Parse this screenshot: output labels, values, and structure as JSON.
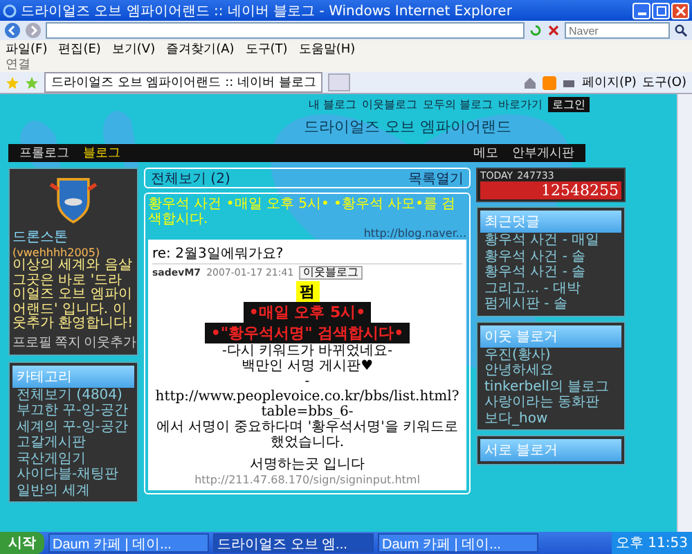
{
  "window": {
    "title": "드라이얼즈 오브 엠파이어랜드 :: 네이버 블로그 - Windows Internet Explorer"
  },
  "address_bar": {
    "search_placeholder": "Naver"
  },
  "menu": [
    "파일(F)",
    "편집(E)",
    "보기(V)",
    "즐겨찾기(A)",
    "도구(T)",
    "도움말(H)"
  ],
  "links_bar": {
    "label": "연결"
  },
  "tabs": [
    {
      "label": "드라이얼즈 오브 엠파이어랜드 :: 네이버 블로그",
      "selected": true
    }
  ],
  "command_bar": [
    "페이지(P)",
    "도구(O)"
  ],
  "blog": {
    "top_links": [
      "내 블로그",
      "이웃블로그",
      "모두의 블로그",
      "바로가기"
    ],
    "login": "로그인",
    "title": "드라이얼즈 오브 엠파이어랜드",
    "nav_left": [
      {
        "label": "프롤로그",
        "selected": false
      },
      {
        "label": "블로그",
        "selected": true
      }
    ],
    "nav_right": [
      "메모",
      "안부게시판"
    ]
  },
  "profile": {
    "name": "드론스톤",
    "id": "(vwehhhh2005)",
    "description": "이상의 세계와 음살 그곳은 바로 '드라이얼즈 오브 엠파이어랜드' 입니다. 이웃추가 환영합니다!",
    "links": [
      "프로필",
      "쪽지",
      "이웃추가"
    ]
  },
  "categories": {
    "title": "카테고리",
    "items": [
      "전체보기 (4804)",
      "부끄한 꾸-잉-공간",
      "세계의 꾸-잉-공간",
      "고갈게시판",
      "국산게임기",
      "사이다블-채팅판",
      "일반의 세계"
    ]
  },
  "post_bar": {
    "label": "전체보기 (2)",
    "action": "목록열기"
  },
  "banner": {
    "text": "황우석 사건 •매일 오후 5시• •황우석 사모•를 검색합시다.",
    "url": "http://blog.naver..."
  },
  "post": {
    "title": "re: 2월3일에뭐가요?",
    "author": "sadevM7",
    "date": "2007-01-17 21:41",
    "button": "이웃블로그",
    "image_lines": [
      {
        "kind": "headline",
        "text": "펌"
      },
      {
        "kind": "alert",
        "text": "•매일 오후 5시•"
      },
      {
        "kind": "alert",
        "text": "•\"황우석서명\" 검색합시다•"
      },
      {
        "kind": "plain",
        "text": "-다시 키워드가 바뀌었네요-"
      },
      {
        "kind": "plain",
        "text": "백만인 서명 게시판♥"
      },
      {
        "kind": "plain",
        "text": "- http://www.peoplevoice.co.kr/bbs/list.html?table=bbs_6-"
      },
      {
        "kind": "plain",
        "text": "에서 서명이 중요하다며 '황우석서명'을 키워드로 했었습니다."
      },
      {
        "kind": "big",
        "text": "서명하는곳 입니다"
      },
      {
        "kind": "link",
        "text": "http://211.47.68.170/sign/signinput.html"
      }
    ]
  },
  "today": {
    "label": "TODAY",
    "today_count": "247733",
    "total": "12548255"
  },
  "recent_comments": {
    "title": "최근덧글",
    "items": [
      "황우석 사건 - 매일",
      "황우석 사건 - 솔",
      "황우석 사건 - 솔",
      "그리고... - 대박",
      "펌게시판 - 솔"
    ]
  },
  "neighbors": {
    "title": "이웃 블로거",
    "items": [
      "우진(황사)",
      "안녕하세요",
      "tinkerbell의 블로그",
      "사랑이라는 동화판",
      "보다_how"
    ]
  },
  "mutual": {
    "title": "서로 블로거"
  },
  "taskbar": {
    "start": "시작",
    "buttons": [
      {
        "label": "Daum 카페 | 데이...",
        "selected": false
      },
      {
        "label": "드라이얼즈 오브 엠...",
        "selected": true
      },
      {
        "label": "Daum 카페 | 데이...",
        "selected": false
      }
    ],
    "clock": "오후 11:53"
  }
}
